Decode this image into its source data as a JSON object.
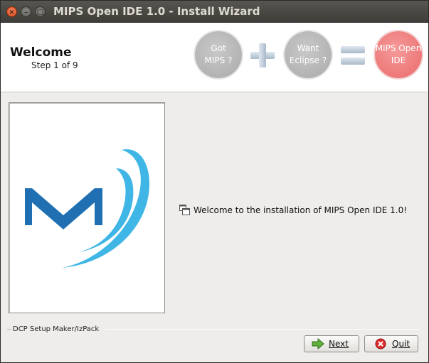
{
  "window": {
    "title": "MIPS Open IDE 1.0 - Install Wizard",
    "controls": {
      "close": "×",
      "minimize": "–",
      "maximize": "□"
    }
  },
  "header": {
    "title": "Welcome",
    "step": "Step 1 of 9",
    "badges": {
      "got_mips": [
        "Got",
        "MIPS ?"
      ],
      "want_eclipse": [
        "Want",
        "Eclipse ?"
      ],
      "result": [
        "MIPS Open",
        "IDE"
      ]
    }
  },
  "content": {
    "message": "Welcome to the installation of MIPS Open IDE 1.0!"
  },
  "footer": {
    "label": "DCP Setup Maker/IzPack",
    "next_label": "Next",
    "quit_label": "Quit"
  },
  "colors": {
    "logo_blue_dark": "#1f6fb2",
    "logo_blue_light": "#3fb6e6",
    "badge_gray": "#b3b3b3",
    "badge_red": "#ef7474"
  },
  "icons": {
    "next": "green-arrow-icon",
    "quit": "red-cancel-icon",
    "message": "window-icon"
  }
}
